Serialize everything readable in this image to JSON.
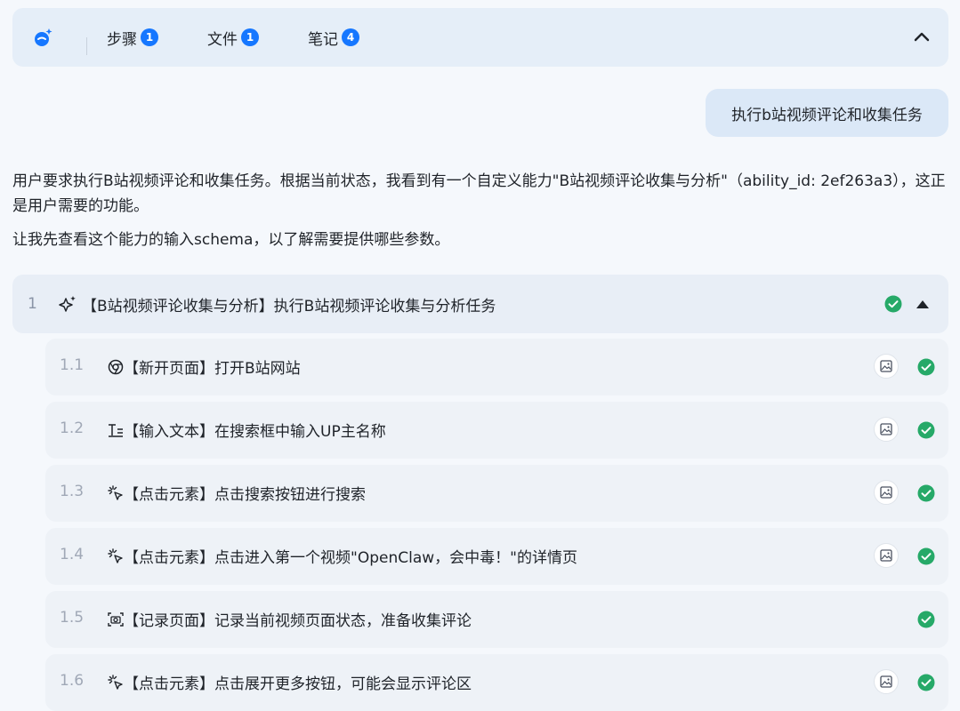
{
  "tabs": [
    {
      "label": "步骤",
      "count": "1"
    },
    {
      "label": "文件",
      "count": "1"
    },
    {
      "label": "笔记",
      "count": "4"
    }
  ],
  "user_message": "执行b站视频评论和收集任务",
  "assistant": {
    "paragraph1": "用户要求执行B站视频评论和收集任务。根据当前状态，我看到有一个自定义能力\"B站视频评论收集与分析\"（ability_id: 2ef263a3），这正是用户需要的功能。",
    "paragraph2": "让我先查看这个能力的输入schema，以了解需要提供哪些参数。"
  },
  "task": {
    "number": "1",
    "title": "【B站视频评论收集与分析】执行B站视频评论收集与分析任务",
    "icon": "sparkle-icon",
    "status": "success"
  },
  "steps": [
    {
      "number": "1.1",
      "text": "【新开页面】打开B站网站",
      "icon": "browser-icon",
      "has_screenshot": true
    },
    {
      "number": "1.2",
      "text": "【输入文本】在搜索框中输入UP主名称",
      "icon": "text-input-icon",
      "has_screenshot": true
    },
    {
      "number": "1.3",
      "text": "【点击元素】点击搜索按钮进行搜索",
      "icon": "click-icon",
      "has_screenshot": true
    },
    {
      "number": "1.4",
      "text": "【点击元素】点击进入第一个视频\"OpenClaw，会中毒！\"的详情页",
      "icon": "click-icon",
      "has_screenshot": true
    },
    {
      "number": "1.5",
      "text": "【记录页面】记录当前视频页面状态，准备收集评论",
      "icon": "camera-icon",
      "has_screenshot": false
    },
    {
      "number": "1.6",
      "text": "【点击元素】点击展开更多按钮，可能会显示评论区",
      "icon": "click-icon",
      "has_screenshot": true
    }
  ],
  "colors": {
    "accent": "#1677ff",
    "success": "#26a968",
    "topbar_bg": "#e5eef8",
    "bubble_bg": "#dbe8f7"
  }
}
